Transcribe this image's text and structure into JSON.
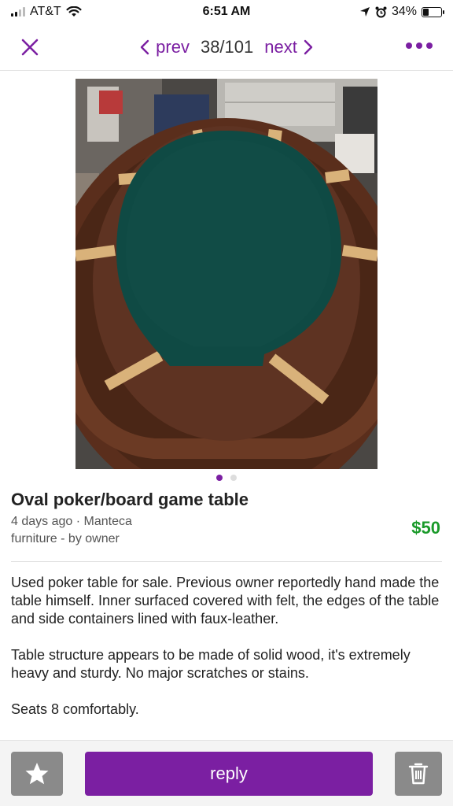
{
  "status_bar": {
    "carrier": "AT&T",
    "time": "6:51 AM",
    "battery_percent": "34%",
    "battery_level": 0.34,
    "icons": [
      "signal-icon",
      "wifi-icon",
      "location-icon",
      "alarm-icon",
      "battery-icon"
    ]
  },
  "nav": {
    "close_icon": "close-icon",
    "prev_label": "prev",
    "next_label": "next",
    "position": "38/101",
    "more_icon": "more-icon"
  },
  "listing": {
    "image_description": "oval-poker-table-photo",
    "carousel_total": 2,
    "carousel_active": 1,
    "title": "Oval poker/board game table",
    "posted": "4 days ago · Manteca",
    "category": "furniture - by owner",
    "price": "$50",
    "description": [
      "Used poker table for sale. Previous owner reportedly hand made the table himself. Inner surfaced covered with felt, the edges of the table and side containers lined with faux-leather.",
      "Table structure appears to be made of solid wood, it's extremely heavy and sturdy. No major scratches or stains.",
      "Seats 8 comfortably."
    ]
  },
  "actions": {
    "favorite_icon": "star-icon",
    "reply_label": "reply",
    "delete_icon": "trash-icon"
  },
  "colors": {
    "accent": "#7b1fa2",
    "price": "#1a9a2a",
    "button_gray": "#8a8a8a"
  }
}
